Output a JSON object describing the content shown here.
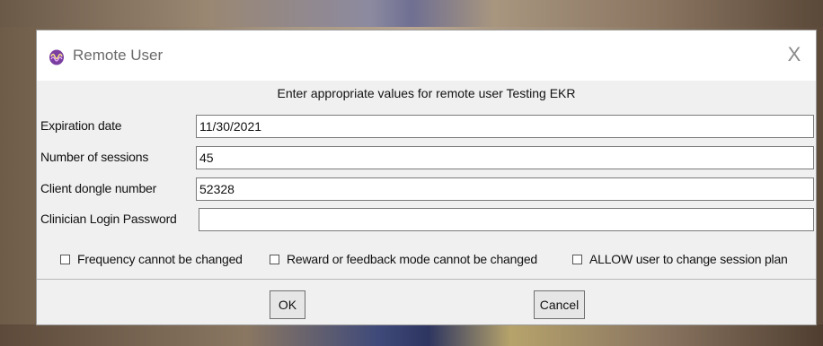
{
  "dialog": {
    "title": "Remote User",
    "instruction": "Enter appropriate values for remote user Testing EKR",
    "close_label": "X",
    "fields": [
      {
        "label": "Expiration date",
        "value": "11/30/2021"
      },
      {
        "label": "Number of sessions",
        "value": "45"
      },
      {
        "label": "Client dongle number",
        "value": "52328"
      },
      {
        "label": "Clinician Login Password",
        "value": ""
      }
    ],
    "checkboxes": [
      {
        "label": "Frequency cannot be changed",
        "checked": false
      },
      {
        "label": "Reward or feedback mode cannot be changed",
        "checked": false
      },
      {
        "label": "ALLOW user to change session plan",
        "checked": false
      }
    ],
    "ok_label": "OK",
    "cancel_label": "Cancel"
  }
}
